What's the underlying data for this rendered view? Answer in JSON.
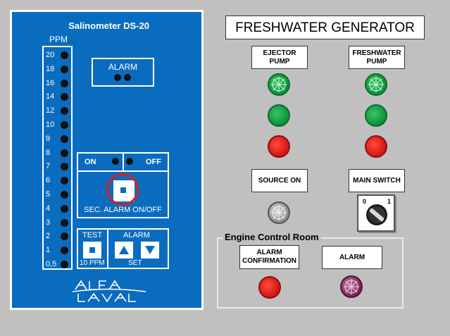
{
  "salinometer": {
    "title": "Salinometer DS-20",
    "ppm_label": "PPM",
    "scale": [
      "20",
      "18",
      "16",
      "14",
      "12",
      "10",
      "9",
      "8",
      "7",
      "6",
      "5",
      "4",
      "3",
      "2",
      "1",
      "0,5"
    ],
    "alarm_label": "ALARM",
    "on_label": "ON",
    "off_label": "OFF",
    "sec_alarm_label": "SEC. ALARM ON/OFF",
    "test_label": "TEST",
    "test_sub_label": "10 PPM",
    "alarm_set_label": "ALARM",
    "set_label": "SET"
  },
  "generator": {
    "title": "FRESHWATER GENERATOR",
    "ejector_pump": "EJECTOR PUMP",
    "freshwater_pump": "FRESHWATER PUMP",
    "source_on": "SOURCE ON",
    "main_switch": "MAIN SWITCH",
    "switch_off": "0",
    "switch_on": "1"
  },
  "ecr": {
    "title": "Engine Control Room",
    "alarm_confirmation": "ALARM CONFIRMATION",
    "alarm": "ALARM"
  },
  "colors": {
    "panel_blue": "#0a6cbf",
    "lamp_green": "#08923a",
    "lamp_red": "#d41414",
    "lamp_gray": "#9a9a9a",
    "lamp_purple": "#8a2d5c",
    "highlight_ring": "#d81e1e"
  },
  "icons": [
    "square-button-icon",
    "arrow-up-icon",
    "arrow-down-icon",
    "rotary-switch-icon",
    "alfa-laval-logo"
  ]
}
